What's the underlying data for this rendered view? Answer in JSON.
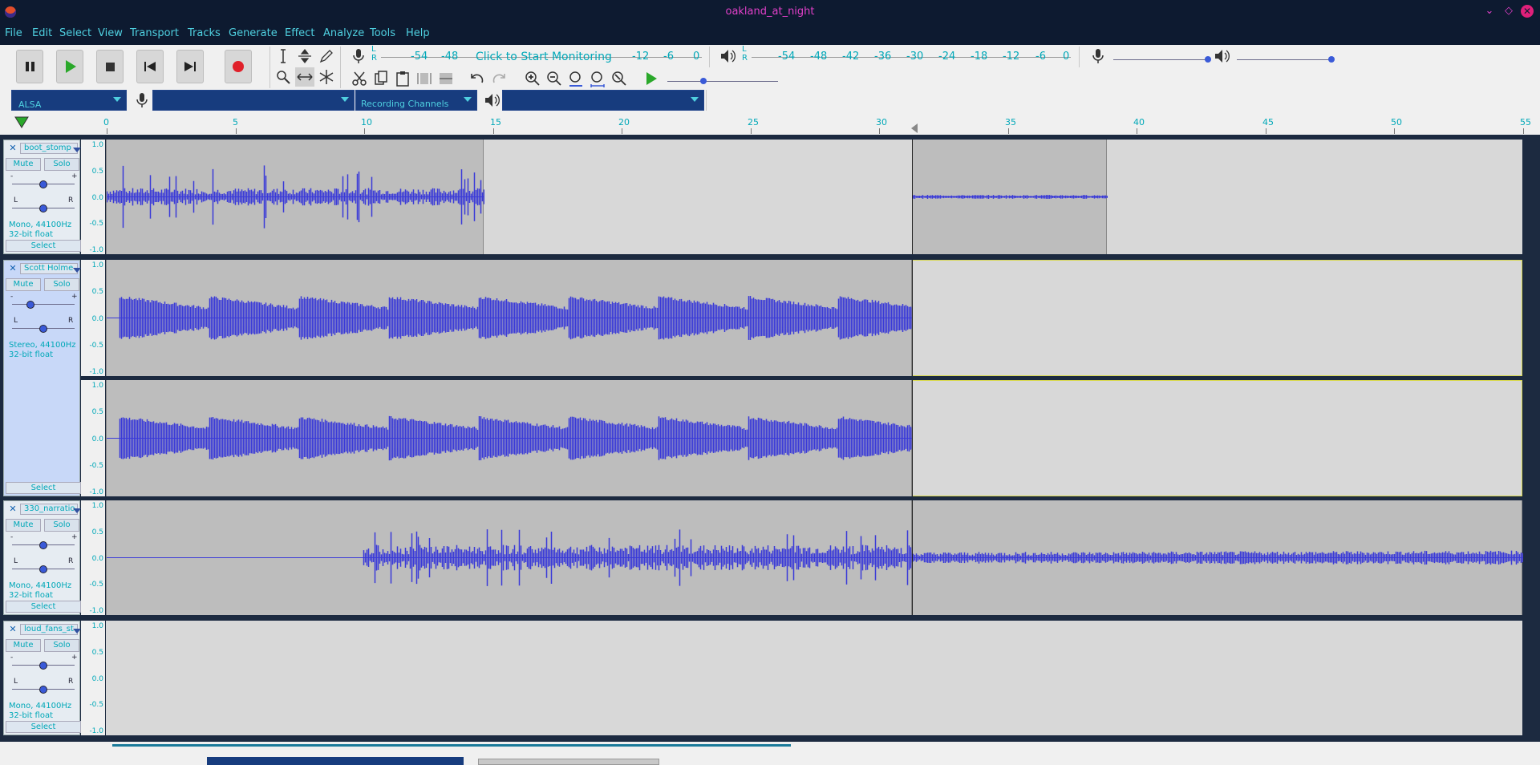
{
  "window": {
    "title": "oakland_at_night",
    "min_label": "⌄",
    "max_label": "◇",
    "close_label": "✕"
  },
  "menu": [
    "File",
    "Edit",
    "Select",
    "View",
    "Transport",
    "Tracks",
    "Generate",
    "Effect",
    "Analyze",
    "Tools",
    "Help"
  ],
  "transport": {
    "pause": "pause-icon",
    "play": "play-icon",
    "stop": "stop-icon",
    "skip_start": "skip-start-icon",
    "skip_end": "skip-end-icon",
    "record": "record-icon"
  },
  "meters": {
    "record_lr": "L\nR",
    "record_ticks": [
      "-54",
      "-48",
      "-12",
      "-6",
      "0"
    ],
    "monitor_label": "Click to Start Monitoring",
    "play_ticks": [
      "-54",
      "-48",
      "-42",
      "-36",
      "-30",
      "-24",
      "-18",
      "-12",
      "-6",
      "0"
    ]
  },
  "devices": {
    "host": "ALSA",
    "recording_device": "",
    "recording_channels": "Recording Channels",
    "playback_device": ""
  },
  "ruler": {
    "ticks": [
      "0",
      "5",
      "10",
      "15",
      "20",
      "25",
      "30",
      "35",
      "40",
      "45",
      "50",
      "55"
    ]
  },
  "vscale": [
    "1.0",
    "0.5",
    "0.0",
    "-0.5",
    "-1.0"
  ],
  "tracks": [
    {
      "name": "boot_stomp",
      "mute": "Mute",
      "solo": "Solo",
      "info1": "Mono, 44100Hz",
      "info2": "32-bit float",
      "select": "Select",
      "gain_minus": "-",
      "gain_plus": "+",
      "pan_l": "L",
      "pan_r": "R",
      "close": "✕"
    },
    {
      "name": "Scott Holme",
      "mute": "Mute",
      "solo": "Solo",
      "info1": "Stereo, 44100Hz",
      "info2": "32-bit float",
      "select": "Select",
      "gain_minus": "-",
      "gain_plus": "+",
      "pan_l": "L",
      "pan_r": "R",
      "close": "✕"
    },
    {
      "name": "330_narratio",
      "mute": "Mute",
      "solo": "Solo",
      "info1": "Mono, 44100Hz",
      "info2": "32-bit float",
      "select": "Select",
      "gain_minus": "-",
      "gain_plus": "+",
      "pan_l": "L",
      "pan_r": "R",
      "close": "✕"
    },
    {
      "name": "loud_fans_st",
      "mute": "Mute",
      "solo": "Solo",
      "info1": "Mono, 44100Hz",
      "info2": "32-bit float",
      "select": "Select",
      "gain_minus": "-",
      "gain_plus": "+",
      "pan_l": "L",
      "pan_r": "R",
      "close": "✕"
    }
  ],
  "colors": {
    "accent": "#00a8b8",
    "waveform": "#3a3ad8",
    "record": "#e0202a",
    "play": "#2aa82a",
    "titlebar": "#0d1a30",
    "title_text": "#e040c8"
  }
}
